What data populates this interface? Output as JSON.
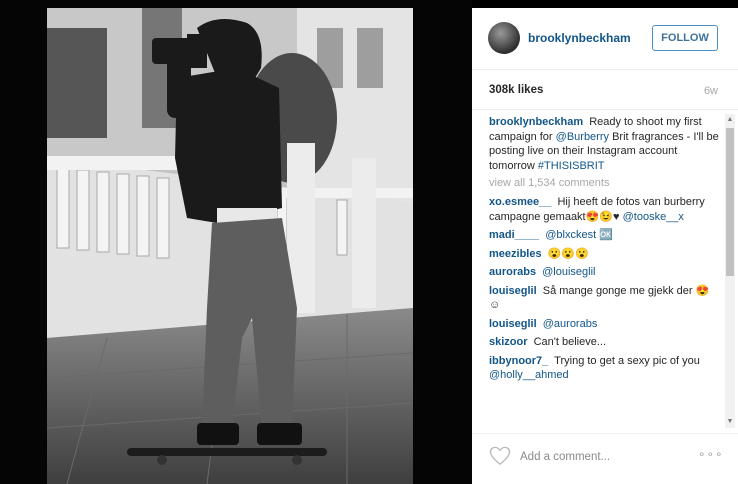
{
  "post": {
    "username": "brooklynbeckham",
    "follow_label": "FOLLOW",
    "likes": "308k likes",
    "age": "6w"
  },
  "caption": {
    "user": "brooklynbeckham",
    "text_1": "Ready to shoot my first campaign for",
    "mention": "@Burberry",
    "text_2": "Brit fragrances - I'll be posting live on their Instagram account tomorrow",
    "hashtag": "#THISISBRIT"
  },
  "view_all": "view all 1,534 comments",
  "comments": [
    {
      "user": "xo.esmee__",
      "text": "Hij heeft de fotos van burberry campagne gemaakt😍😉♥",
      "mention": "@tooske__x"
    },
    {
      "user": "madi____",
      "text": "",
      "mention": "@blxckest",
      "suffix": "🆗"
    },
    {
      "user": "meezibles",
      "text": "😮😮😮",
      "mention": ""
    },
    {
      "user": "aurorabs",
      "text": "",
      "mention": "@louiseglil"
    },
    {
      "user": "louiseglil",
      "text": "Så mange gonge me gjekk der 😍☺",
      "mention": ""
    },
    {
      "user": "louiseglil",
      "text": "",
      "mention": "@aurorabs"
    },
    {
      "user": "skizoor",
      "text": "Can't believe...",
      "mention": ""
    },
    {
      "user": "ibbynoor7_",
      "text": "Trying to get a sexy pic of you",
      "mention": "@holly__ahmed"
    }
  ],
  "footer": {
    "add_comment_placeholder": "Add a comment...",
    "more_label": "∘∘∘"
  },
  "icons": {
    "avatar": "profile-avatar",
    "like": "heart-outline-icon",
    "more": "more-options-icon"
  },
  "colors": {
    "link_blue": "#125688",
    "follow_border": "#4a90c8",
    "muted_gray": "#a5a7aa",
    "text_dark": "#262626"
  }
}
